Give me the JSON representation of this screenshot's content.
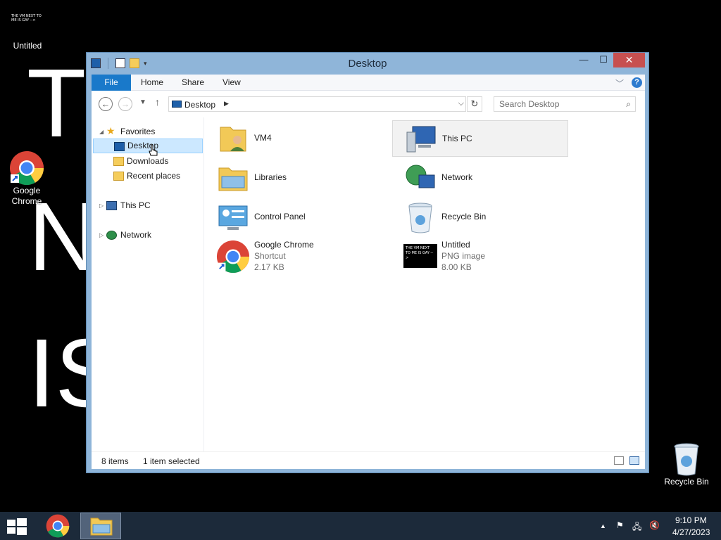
{
  "wallpaper": {
    "line1": "T",
    "line2": "N",
    "line3": "IS"
  },
  "desktop_icons": {
    "untitled": {
      "label": "Untitled",
      "thumb_text": "THE VM NEXT TO ME IS GAY -->"
    },
    "chrome": {
      "label": "Google Chrome"
    },
    "recycle": {
      "label": "Recycle Bin"
    }
  },
  "window": {
    "title": "Desktop",
    "controls": {
      "minimize": "—",
      "maximize": "☐",
      "close": "✕"
    },
    "ribbon": {
      "file": "File",
      "home": "Home",
      "share": "Share",
      "view": "View",
      "help": "?"
    },
    "address": {
      "path": "Desktop",
      "search_placeholder": "Search Desktop"
    },
    "nav": {
      "favorites": "Favorites",
      "desktop": "Desktop",
      "downloads": "Downloads",
      "recent": "Recent places",
      "thispc": "This PC",
      "network": "Network"
    },
    "items": [
      {
        "name": "VM4"
      },
      {
        "name": "This PC"
      },
      {
        "name": "Libraries"
      },
      {
        "name": "Network"
      },
      {
        "name": "Control Panel"
      },
      {
        "name": "Recycle Bin"
      },
      {
        "name": "Google Chrome",
        "type": "Shortcut",
        "size": "2.17 KB"
      },
      {
        "name": "Untitled",
        "type": "PNG image",
        "size": "8.00 KB",
        "thumb_text": "THE VM NEXT TO ME IS GAY -->"
      }
    ],
    "status": {
      "count": "8 items",
      "selected": "1 item selected"
    }
  },
  "taskbar": {
    "time": "9:10 PM",
    "date": "4/27/2023"
  },
  "colors": {
    "accent": "#1979ca",
    "frame": "#8fb5d9",
    "close": "#c75050",
    "taskbar": "#1c2a3a"
  }
}
